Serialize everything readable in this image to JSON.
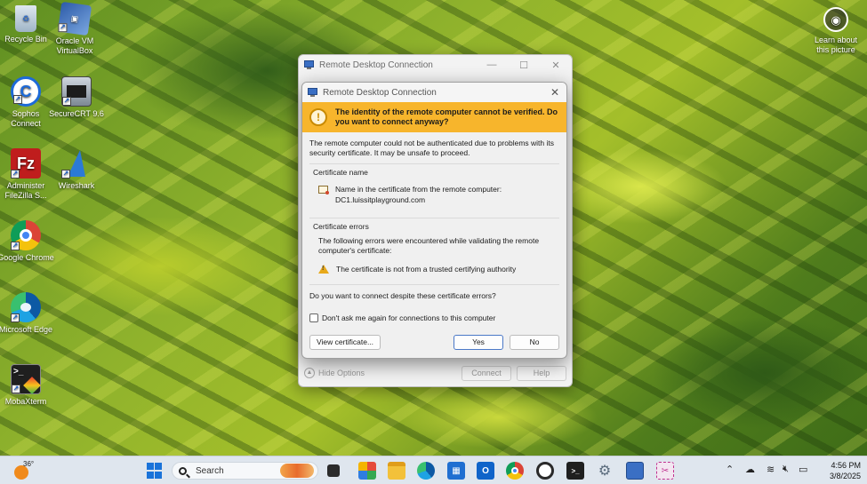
{
  "desktop": {
    "icons": [
      {
        "label": "Recycle Bin"
      },
      {
        "label": "Oracle VM VirtualBox"
      },
      {
        "label": "Sophos Connect"
      },
      {
        "label": "SecureCRT 9.6"
      },
      {
        "label": "Administer FileZilla S..."
      },
      {
        "label": "Wireshark"
      },
      {
        "label": "Google Chrome"
      },
      {
        "label": "Microsoft Edge"
      },
      {
        "label": "MobaXterm"
      }
    ],
    "learn_picture": "Learn about this picture"
  },
  "rdc_main": {
    "title": "Remote Desktop Connection",
    "hide_options": "Hide Options",
    "connect": "Connect",
    "help": "Help"
  },
  "dialog": {
    "title": "Remote Desktop Connection",
    "warning": "The identity of the remote computer cannot be verified. Do you want to connect anyway?",
    "description": "The remote computer could not be authenticated due to problems with its security certificate. It may be unsafe to proceed.",
    "cert_name_title": "Certificate name",
    "cert_name_label": "Name in the certificate from the remote computer:",
    "cert_name_value": "DC1.luissitplayground.com",
    "cert_errors_title": "Certificate errors",
    "cert_errors_text": "The following errors were encountered while validating the remote computer's certificate:",
    "cert_error_item": "The certificate is not from a trusted certifying authority",
    "question": "Do you want to connect despite these certificate errors?",
    "checkbox_label": "Don't ask me again for connections to this computer",
    "checkbox_checked": false,
    "view_certificate": "View certificate...",
    "yes": "Yes",
    "no": "No"
  },
  "taskbar": {
    "weather_temp": "36°",
    "search_placeholder": "Search",
    "time": "4:56 PM",
    "date": "3/8/2025"
  },
  "colors": {
    "warning_bar": "#f7b52c",
    "taskbar": "#dfe6ee"
  }
}
